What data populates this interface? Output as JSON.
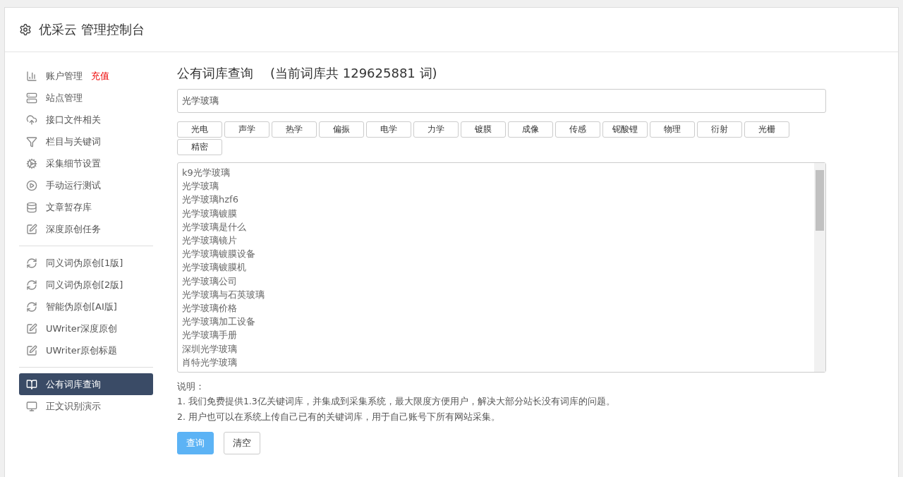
{
  "header": {
    "title": "优采云 管理控制台"
  },
  "sidebar": {
    "groups": [
      {
        "items": [
          {
            "label": "账户管理",
            "badge": "充值",
            "selected": false
          },
          {
            "label": "站点管理",
            "selected": false
          },
          {
            "label": "接口文件相关",
            "selected": false
          },
          {
            "label": "栏目与关键词",
            "selected": false
          },
          {
            "label": "采集细节设置",
            "selected": false
          },
          {
            "label": "手动运行测试",
            "selected": false
          },
          {
            "label": "文章暂存库",
            "selected": false
          },
          {
            "label": "深度原创任务",
            "selected": false
          }
        ]
      },
      {
        "items": [
          {
            "label": "同义词伪原创[1版]",
            "selected": false
          },
          {
            "label": "同义词伪原创[2版]",
            "selected": false
          },
          {
            "label": "智能伪原创[AI版]",
            "selected": false
          },
          {
            "label": "UWriter深度原创",
            "selected": false
          },
          {
            "label": "UWriter原创标题",
            "selected": false
          }
        ]
      },
      {
        "items": [
          {
            "label": "公有词库查询",
            "selected": true
          },
          {
            "label": "正文识别演示",
            "selected": false
          }
        ]
      }
    ]
  },
  "main": {
    "title": "公有词库查询",
    "subtitle": "(当前词库共 129625881 词)",
    "search": {
      "value": "光学玻璃"
    },
    "tags": [
      "光电",
      "声学",
      "热学",
      "偏振",
      "电学",
      "力学",
      "镀膜",
      "成像",
      "传感",
      "铌酸锂",
      "物理",
      "衍射",
      "光栅",
      "精密"
    ],
    "results": [
      "k9光学玻璃",
      "光学玻璃",
      "光学玻璃hzf6",
      "光学玻璃镀膜",
      "光学玻璃是什么",
      "光学玻璃镜片",
      "光学玻璃镀膜设备",
      "光学玻璃镀膜机",
      "光学玻璃公司",
      "光学玻璃与石英玻璃",
      "光学玻璃价格",
      "光学玻璃加工设备",
      "光学玻璃手册",
      "深圳光学玻璃",
      "肖特光学玻璃"
    ],
    "notes_title": "说明：",
    "notes": [
      "1. 我们免费提供1.3亿关键词库，并集成到采集系统，最大限度方便用户，解决大部分站长没有词库的问题。",
      "2. 用户也可以在系统上传自己已有的关键词库，用于自己账号下所有网站采集。"
    ],
    "buttons": [
      {
        "label": "查询",
        "kind": "primary"
      },
      {
        "label": "清空",
        "kind": "default"
      }
    ]
  }
}
